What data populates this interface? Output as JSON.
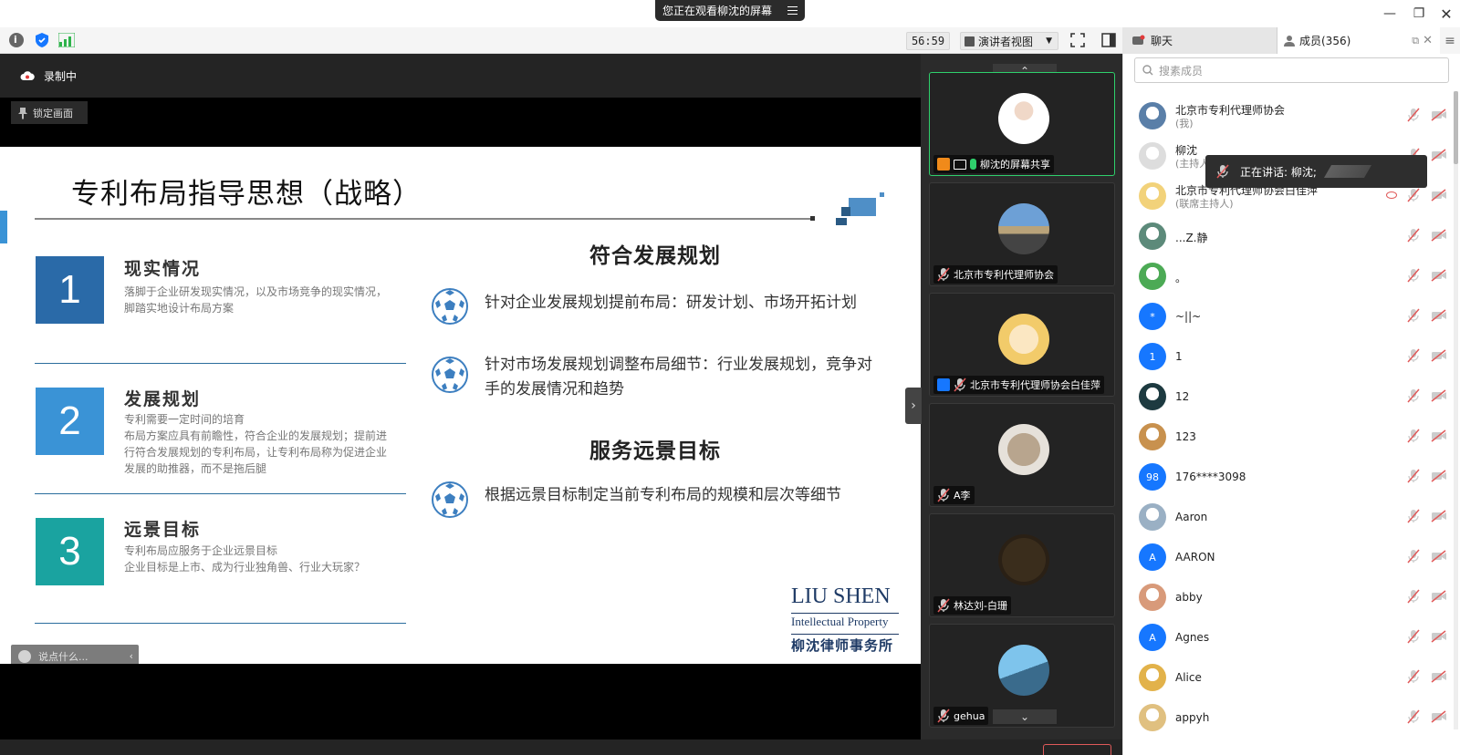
{
  "banner": {
    "text": "您正在观看柳沈的屏幕"
  },
  "toolbar": {
    "timer": "56:59",
    "view_mode": "演讲者视图"
  },
  "tabs": {
    "chat": "聊天",
    "members": "成员(356)"
  },
  "recording": {
    "label": "录制中"
  },
  "lock": {
    "label": "锁定画面"
  },
  "slide": {
    "title": "专利布局指导思想（战略）",
    "sections": [
      {
        "num": "1",
        "heading": "现实情况",
        "text": "落脚于企业研发现实情况，以及市场竞争的现实情况，脚踏实地设计布局方案"
      },
      {
        "num": "2",
        "heading": "发展规划",
        "text": "专利需要一定时间的培育\n布局方案应具有前瞻性，符合企业的发展规划；提前进行符合发展规划的专利布局，让专利布局称为促进企业发展的助推器，而不是拖后腿"
      },
      {
        "num": "3",
        "heading": "远景目标",
        "text": "专利布局应服务于企业远景目标\n企业目标是上市、成为行业独角兽、行业大玩家？"
      }
    ],
    "right_title_1": "符合发展规划",
    "bullet_1": "针对企业发展规划提前布局：研发计划、市场开拓计划",
    "bullet_2": "针对市场发展规划调整布局细节：行业发展规划，竞争对手的发展情况和趋势",
    "right_title_2": "服务远景目标",
    "bullet_3": "根据远景目标制定当前专利布局的规模和层次等细节",
    "logo_en_1": "LIU SHEN",
    "logo_en_2": "Intellectual Property",
    "logo_cn": "柳沈律师事务所"
  },
  "chat_input": {
    "placeholder": "说点什么..."
  },
  "tiles": [
    {
      "name": "柳沈的屏幕共享"
    },
    {
      "name": "北京市专利代理师协会"
    },
    {
      "name": "北京市专利代理师协会白佳萍"
    },
    {
      "name": "A李"
    },
    {
      "name": "林达刘-白珊"
    },
    {
      "name": "gehua"
    }
  ],
  "search": {
    "placeholder": "搜素成员"
  },
  "speaking": {
    "text": "正在讲话: 柳沈;"
  },
  "members": [
    {
      "name": "北京市专利代理师协会",
      "role": "(我)",
      "avatar": "road",
      "color": "#5a7fa8"
    },
    {
      "name": "柳沈",
      "role": "(主持人)",
      "avatar": "person",
      "color": "#ddd"
    },
    {
      "name": "北京市专利代理师协会白佳萍",
      "role": "(联席主持人)",
      "avatar": "girl",
      "color": "#f2d27a"
    },
    {
      "name": "...Z.静",
      "role": "",
      "avatar": "img",
      "color": "#5c8a7a"
    },
    {
      "name": "。",
      "role": "",
      "avatar": "img",
      "color": "#4caa55"
    },
    {
      "name": "~||~",
      "role": "",
      "avatar": "letter",
      "letter": "*",
      "color": "#1677ff"
    },
    {
      "name": "1",
      "role": "",
      "avatar": "letter",
      "letter": "1",
      "color": "#1677ff"
    },
    {
      "name": "12",
      "role": "",
      "avatar": "img",
      "color": "#1d3a40"
    },
    {
      "name": "123",
      "role": "",
      "avatar": "img",
      "color": "#c8914e"
    },
    {
      "name": "176****3098",
      "role": "",
      "avatar": "letter",
      "letter": "98",
      "color": "#1677ff"
    },
    {
      "name": "Aaron",
      "role": "",
      "avatar": "img",
      "color": "#9ab0c4"
    },
    {
      "name": "AARON",
      "role": "",
      "avatar": "letter",
      "letter": "A",
      "color": "#1677ff"
    },
    {
      "name": "abby",
      "role": "",
      "avatar": "img",
      "color": "#d89a7a"
    },
    {
      "name": "Agnes",
      "role": "",
      "avatar": "letter",
      "letter": "A",
      "color": "#1677ff"
    },
    {
      "name": "Alice",
      "role": "",
      "avatar": "img",
      "color": "#e2b24a"
    },
    {
      "name": "appyh",
      "role": "",
      "avatar": "img",
      "color": "#e0c080"
    }
  ],
  "colors": {
    "box1": "#2a6aa8",
    "box2": "#3a93d6",
    "box3": "#1aa3a0",
    "accent": "#1677ff",
    "active_border": "#2fd06c",
    "muted_red": "#e05a5a"
  }
}
